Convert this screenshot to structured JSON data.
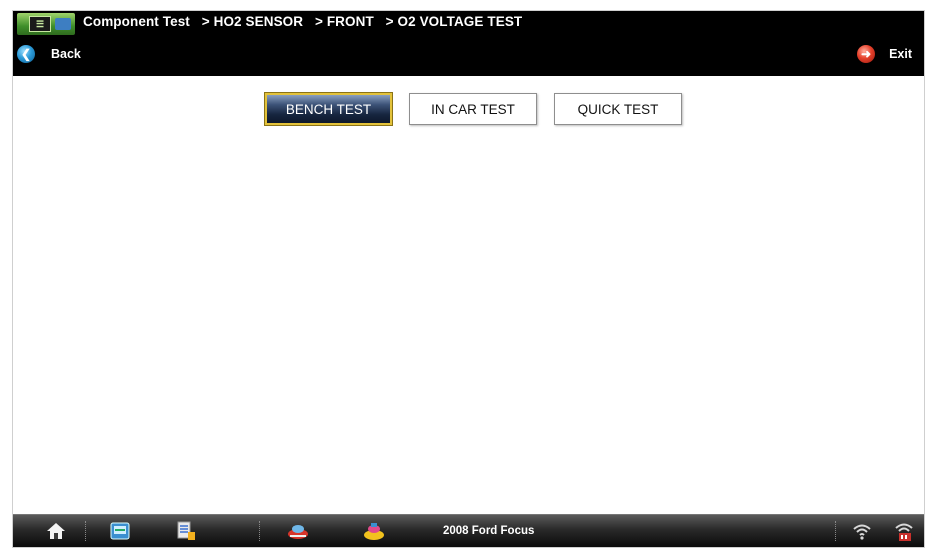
{
  "header": {
    "breadcrumb": [
      "Component Test",
      "> HO2 SENSOR",
      "> FRONT",
      "> O2 VOLTAGE TEST"
    ],
    "back_label": "Back",
    "exit_label": "Exit"
  },
  "tabs": [
    {
      "label": "BENCH TEST",
      "selected": true
    },
    {
      "label": "IN CAR TEST",
      "selected": false
    },
    {
      "label": "QUICK TEST",
      "selected": false
    }
  ],
  "taskbar": {
    "vehicle": "2008 Ford Focus",
    "icons": [
      "home-icon",
      "scanner-icon",
      "data-tools-icon",
      "vehicle-red-icon",
      "vehicle-yellow-icon",
      "wifi-icon",
      "vci-status-icon"
    ]
  },
  "colors": {
    "titlebar": "#000000",
    "active_tab_border": "#e3c23a",
    "active_tab_fill": "#16253f",
    "back_icon": "#2b9ad8",
    "exit_icon": "#e5402a"
  }
}
